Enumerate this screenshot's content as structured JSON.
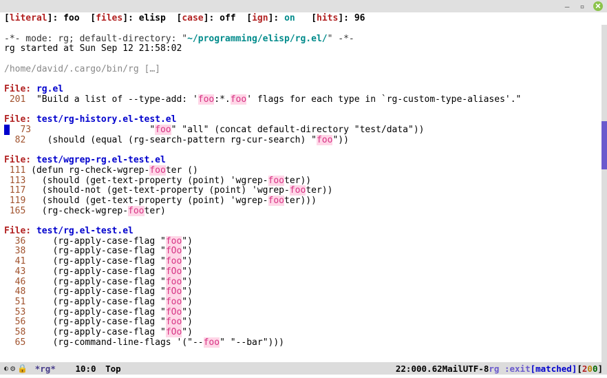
{
  "header": {
    "literal_lbl": "literal",
    "literal_val": "foo",
    "files_lbl": "files",
    "files_val": "elisp",
    "case_lbl": "case",
    "case_val": "off",
    "ign_lbl": "ign",
    "ign_val": "on",
    "hits_lbl": "hits",
    "hits_val": "96"
  },
  "mode": {
    "line": "-*- mode: rg; default-directory: \"",
    "path": "~/programming/elisp/rg.el/",
    "line_end": "\" -*-",
    "started": "rg started at Sun Sep 12 21:58:02"
  },
  "cargo": {
    "path": "/home/david/.cargo/bin/rg",
    "ellipsis": " […]"
  },
  "file_lbl": "File: ",
  "files": [
    {
      "name": "rg.el",
      "rows": [
        {
          "n": " 201",
          "pre": "  \"Build a list of --type-add: '",
          "m1": "foo",
          "mid": ":*.",
          "m2": "foo",
          "post": "' flags for each type in `rg-custom-type-aliases'.\""
        }
      ]
    },
    {
      "name": "test/rg-history.el-test.el",
      "rows": [
        {
          "n": "  73",
          "cursor": true,
          "pre": "                      \"",
          "m1": "foo",
          "post": "\" \"all\" (concat default-directory \"test/data\"))"
        },
        {
          "n": "  82",
          "pre": "    (should (equal (rg-search-pattern rg-cur-search) \"",
          "m1": "foo",
          "post": "\"))"
        }
      ]
    },
    {
      "name": "test/wgrep-rg.el-test.el",
      "rows": [
        {
          "n": " 111",
          "pre": " (defun rg-check-wgrep-",
          "m1": "foo",
          "post": "ter ()"
        },
        {
          "n": " 113",
          "pre": "   (should (get-text-property (point) 'wgrep-",
          "m1": "foo",
          "post": "ter))"
        },
        {
          "n": " 117",
          "pre": "   (should-not (get-text-property (point) 'wgrep-",
          "m1": "foo",
          "post": "ter))"
        },
        {
          "n": " 119",
          "pre": "   (should (get-text-property (point) 'wgrep-",
          "m1": "foo",
          "post": "ter)))"
        },
        {
          "n": " 165",
          "pre": "   (rg-check-wgrep-",
          "m1": "foo",
          "post": "ter)"
        }
      ]
    },
    {
      "name": "test/rg.el-test.el",
      "rows": [
        {
          "n": "  36",
          "pre": "     (rg-apply-case-flag \"",
          "m1": "foo",
          "post": "\")"
        },
        {
          "n": "  38",
          "pre": "     (rg-apply-case-flag \"",
          "m1": "fOo",
          "post": "\")"
        },
        {
          "n": "  41",
          "pre": "     (rg-apply-case-flag \"",
          "m1": "foo",
          "post": "\")"
        },
        {
          "n": "  43",
          "pre": "     (rg-apply-case-flag \"",
          "m1": "fOo",
          "post": "\")"
        },
        {
          "n": "  46",
          "pre": "     (rg-apply-case-flag \"",
          "m1": "foo",
          "post": "\")"
        },
        {
          "n": "  48",
          "pre": "     (rg-apply-case-flag \"",
          "m1": "fOo",
          "post": "\")"
        },
        {
          "n": "  51",
          "pre": "     (rg-apply-case-flag \"",
          "m1": "foo",
          "post": "\")"
        },
        {
          "n": "  53",
          "pre": "     (rg-apply-case-flag \"",
          "m1": "fOo",
          "post": "\")"
        },
        {
          "n": "  56",
          "pre": "     (rg-apply-case-flag \"",
          "m1": "foo",
          "post": "\")"
        },
        {
          "n": "  58",
          "pre": "     (rg-apply-case-flag \"",
          "m1": "fOo",
          "post": "\")"
        },
        {
          "n": "  65",
          "pre": "     (rg-command-line-flags '(\"--",
          "m1": "foo",
          "post": "\" \"--bar\")))"
        }
      ]
    }
  ],
  "modeline": {
    "buffer": "*rg*",
    "pos": "10:0",
    "loc": "Top",
    "time": "22:00",
    "load": "0.62",
    "mail": "Mail",
    "enc": "UTF-8",
    "rg": "rg",
    "exit": ":exit",
    "status": "[matched]",
    "n1": "2",
    "n2": "0",
    "n3": "0"
  }
}
